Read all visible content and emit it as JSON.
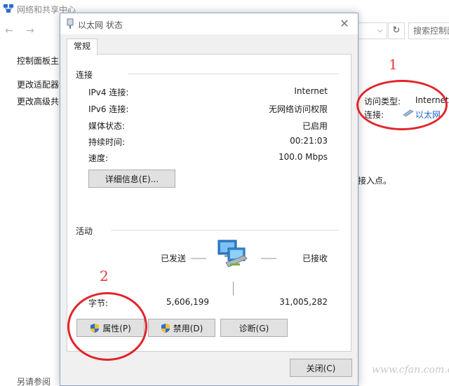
{
  "background": {
    "title": "网络和共享中心",
    "search_placeholder": "搜索控制面",
    "sidebar": {
      "home": "控制面板主页",
      "adapter": "更改适配器设置",
      "advanced": "更改高级共享设置",
      "see_also": "另请参阅"
    },
    "network": {
      "access_type_label": "访问类型:",
      "access_type_value": "Internet",
      "connection_label": "连接:",
      "connection_value": "以太网"
    },
    "setup_text": "或接入点。"
  },
  "dialog": {
    "title": "以太网 状态",
    "close_glyph": "✕",
    "tab": "常规",
    "connection_group": {
      "title": "连接",
      "rows": [
        {
          "label": "IPv4 连接:",
          "value": "Internet"
        },
        {
          "label": "IPv6 连接:",
          "value": "无网络访问权限"
        },
        {
          "label": "媒体状态:",
          "value": "已启用"
        },
        {
          "label": "持续时间:",
          "value": "00:21:03"
        },
        {
          "label": "速度:",
          "value": "100.0 Mbps"
        }
      ],
      "details_button": "详细信息(E)..."
    },
    "activity_group": {
      "title": "活动",
      "sent_label": "已发送",
      "received_label": "已接收",
      "bytes_label": "字节:",
      "bytes_sent": "5,606,199",
      "bytes_received": "31,005,282"
    },
    "buttons": {
      "properties": "属性(P)",
      "disable": "禁用(D)",
      "diagnose": "诊断(G)",
      "close": "关闭(C)"
    }
  },
  "annotations": {
    "marker_1": "1",
    "marker_2": "2"
  },
  "watermark": "www.cfan.com.cn",
  "icons": {
    "app": "network-center-icon",
    "dialog": "ethernet-icon",
    "activity": "network-computers-icon",
    "shield": "uac-shield-icon"
  },
  "colors": {
    "annotation": "#e2242a",
    "link": "#1a64c8",
    "dialog_bg": "#f0f0f0"
  }
}
